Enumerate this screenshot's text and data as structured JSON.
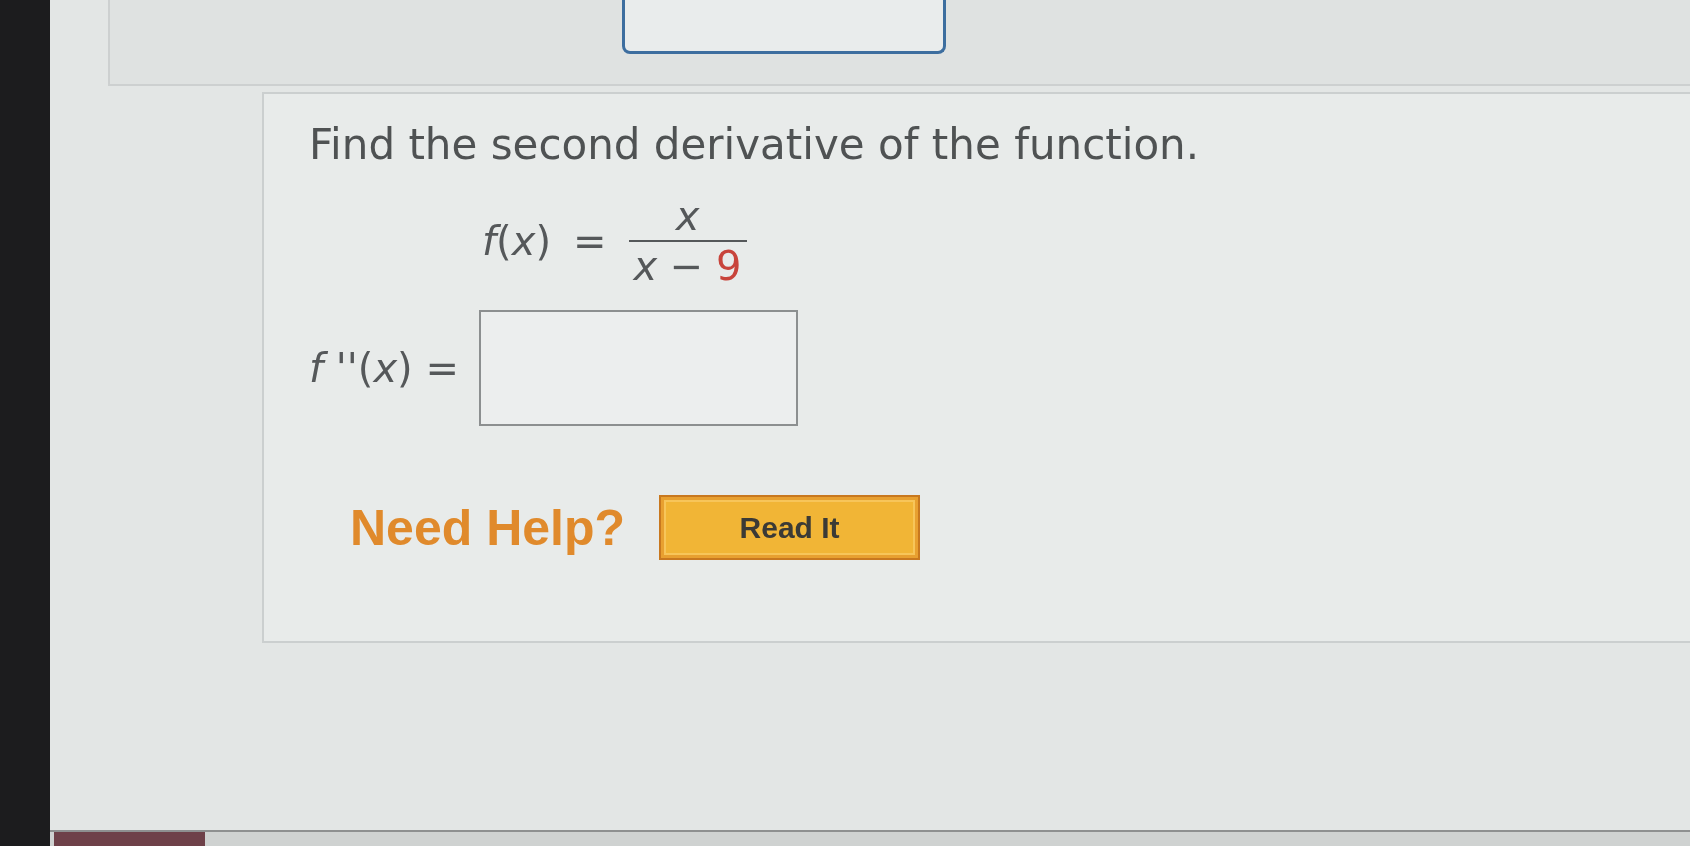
{
  "question": {
    "prompt": "Find the second derivative of the function.",
    "function": {
      "lhs": "*f*(*x*)",
      "equals": "=",
      "numerator": "*x*",
      "denominator": {
        "expression": "*x* −",
        "constant": "9"
      }
    },
    "answer": {
      "label": "*f* ''(*x*) ="
    }
  },
  "help": {
    "label": "Need Help?",
    "buttons": [
      "Read It"
    ]
  }
}
